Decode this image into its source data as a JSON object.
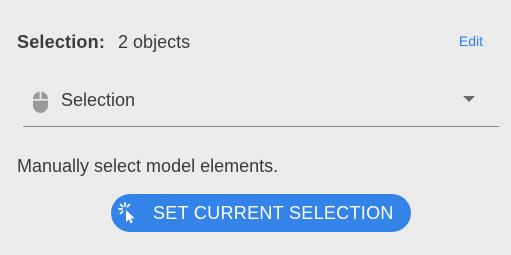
{
  "header": {
    "label": "Selection:",
    "value": "2 objects",
    "edit_label": "Edit"
  },
  "dropdown": {
    "icon": "mouse-icon",
    "selected_value": "Selection"
  },
  "description": "Manually select model elements.",
  "action": {
    "icon": "cursor-click-icon",
    "label": "SET CURRENT SELECTION"
  },
  "colors": {
    "background": "#ebebeb",
    "accent": "#3483e8",
    "link": "#2f7ff0"
  }
}
